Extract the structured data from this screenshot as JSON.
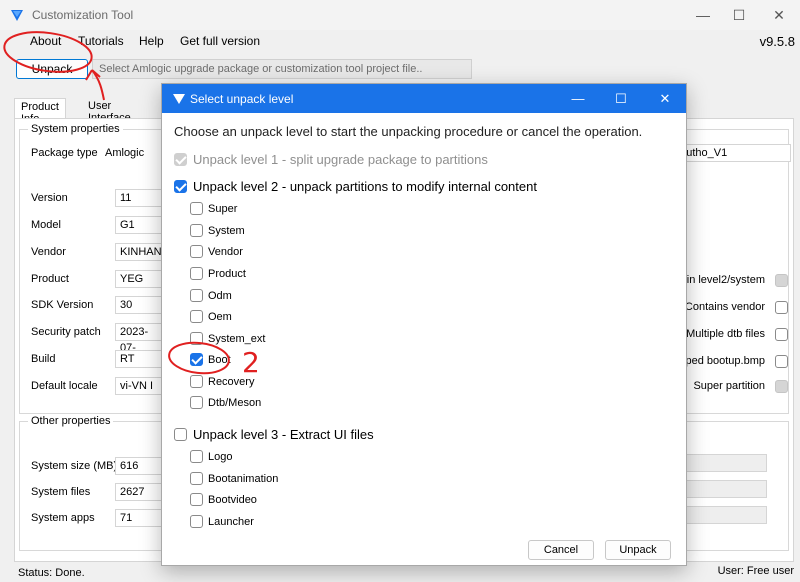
{
  "window": {
    "title": "Customization Tool",
    "minimize": "—",
    "maximize": "☐",
    "close": "✕"
  },
  "menu": {
    "items": [
      "About",
      "Tutorials",
      "Help",
      "Get full version"
    ],
    "version": "v9.5.8"
  },
  "toolbar": {
    "unpack_label": "Unpack",
    "path_placeholder": "Select Amlogic upgrade package or customization tool project file.."
  },
  "tabs": [
    "Product Info",
    "User Interface"
  ],
  "system_properties": {
    "title": "System properties",
    "rows": [
      {
        "label": "Package type",
        "value": "Amlogic"
      },
      {
        "label": "Version",
        "value": "11"
      },
      {
        "label": "Model",
        "value": "G1"
      },
      {
        "label": "Vendor",
        "value": "KINHANH"
      },
      {
        "label": "Product",
        "value": "YEG"
      },
      {
        "label": "SDK Version",
        "value": "30"
      },
      {
        "label": "Security patch",
        "value": "2023-07-"
      },
      {
        "label": "Build",
        "value": "RT"
      },
      {
        "label": "Default locale",
        "value": "vi-VN  I"
      }
    ],
    "package_name_partial": "phutho_V1",
    "flags": [
      {
        "label": "k in level2/system",
        "checked": true
      },
      {
        "label": "Contains vendor",
        "checked": false
      },
      {
        "label": "Multiple dtb files",
        "checked": false
      },
      {
        "label": "pped bootup.bmp",
        "checked": false
      },
      {
        "label": "Super partition",
        "checked": true
      }
    ]
  },
  "other_properties": {
    "title": "Other properties",
    "rows": [
      {
        "label": "System size (MB)",
        "value": "616"
      },
      {
        "label": "System files",
        "value": "2627"
      },
      {
        "label": "System apps",
        "value": "71"
      }
    ]
  },
  "status": {
    "left": "Status:  Done.",
    "right": "User: Free user"
  },
  "dialog": {
    "title": "Select unpack level",
    "instruction": "Choose an unpack level to start the unpacking procedure or cancel the operation.",
    "level1": "Unpack level 1 - split upgrade package to partitions",
    "level2": "Unpack level 2 - unpack partitions to modify internal content",
    "level2_options": [
      {
        "label": "Super",
        "checked": false
      },
      {
        "label": "System",
        "checked": false
      },
      {
        "label": "Vendor",
        "checked": false
      },
      {
        "label": "Product",
        "checked": false
      },
      {
        "label": "Odm",
        "checked": false
      },
      {
        "label": "Oem",
        "checked": false
      },
      {
        "label": "System_ext",
        "checked": false
      },
      {
        "label": "Boot",
        "checked": true
      },
      {
        "label": "Recovery",
        "checked": false
      },
      {
        "label": "Dtb/Meson",
        "checked": false
      }
    ],
    "level3": "Unpack level 3 - Extract UI files",
    "level3_options": [
      {
        "label": "Logo",
        "checked": false
      },
      {
        "label": "Bootanimation",
        "checked": false
      },
      {
        "label": "Bootvideo",
        "checked": false
      },
      {
        "label": "Launcher",
        "checked": false
      }
    ],
    "cancel_label": "Cancel",
    "unpack_label": "Unpack"
  },
  "annotation": {
    "number": "2"
  },
  "colors": {
    "accent": "#1a73e8",
    "annotation": "#e02020"
  }
}
